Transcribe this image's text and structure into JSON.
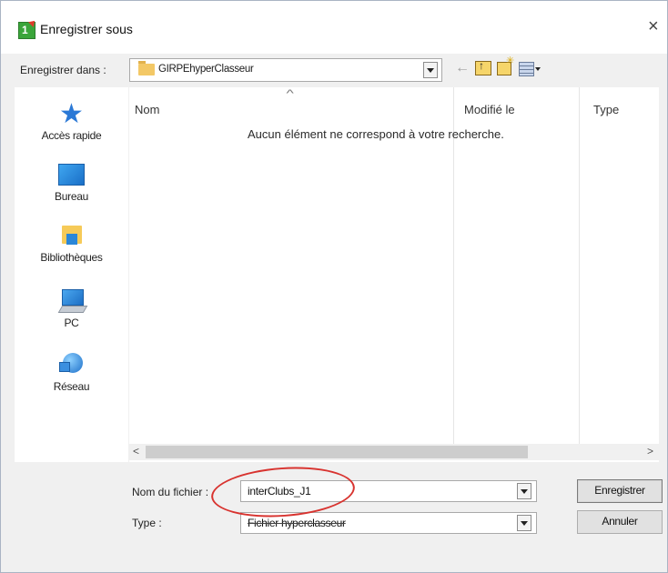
{
  "window": {
    "title": "Enregistrer sous",
    "app_icon_label": "1",
    "close_glyph": "×"
  },
  "save_in": {
    "label": "Enregistrer dans :",
    "value": "GIRPEhyperClasseur"
  },
  "toolbar": {
    "back_glyph": "←",
    "icons": [
      "back-icon",
      "up-folder-icon",
      "new-folder-icon",
      "view-menu-icon"
    ]
  },
  "places": [
    {
      "label": "Accès rapide",
      "icon": "star-icon"
    },
    {
      "label": "Bureau",
      "icon": "desktop-icon"
    },
    {
      "label": "Bibliothèques",
      "icon": "libraries-icon"
    },
    {
      "label": "PC",
      "icon": "computer-icon"
    },
    {
      "label": "Réseau",
      "icon": "network-icon"
    }
  ],
  "file_list": {
    "columns": [
      "Nom",
      "Modifié le",
      "Type"
    ],
    "sort_glyph": "^",
    "empty_message": "Aucun élément ne correspond à votre recherche."
  },
  "scrollbar": {
    "left_glyph": "<",
    "right_glyph": ">"
  },
  "form": {
    "filename_label": "Nom du fichier :",
    "filename_value": "interClubs_J1",
    "type_label": "Type :",
    "type_value": "Fichier hyperclasseur"
  },
  "buttons": {
    "save": "Enregistrer",
    "cancel": "Annuler"
  },
  "colors": {
    "highlight": "#d8332f",
    "window_bg": "#f0f0f0"
  }
}
